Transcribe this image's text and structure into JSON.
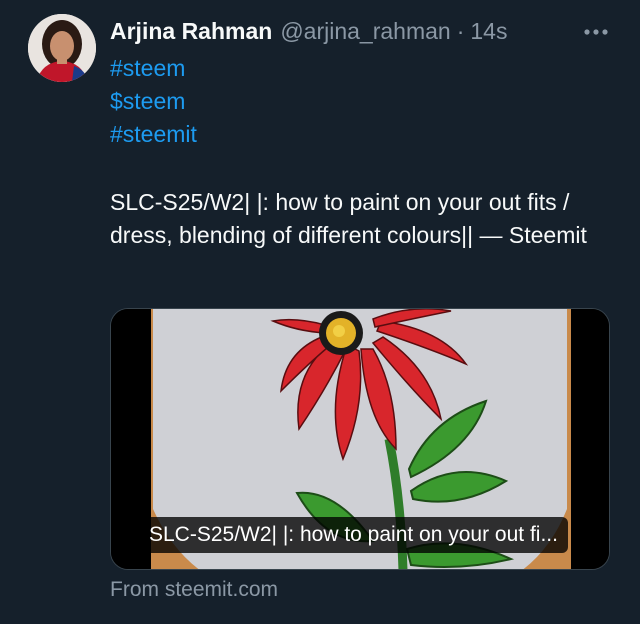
{
  "author": {
    "name": "Arjina Rahman",
    "handle": "@arjina_rahman",
    "separator": "·",
    "time": "14s"
  },
  "tags": [
    "#steem",
    "$steem",
    "#steemit"
  ],
  "body": "SLC-S25/W2| |: how to paint on your out fits / dress, blending of different colours|| — Steemit",
  "card": {
    "title": "SLC-S25/W2| |: how to paint on your out fi...",
    "source": "From steemit.com"
  },
  "icons": {
    "more": "more-horizontal-icon"
  },
  "colors": {
    "background": "#15202b",
    "link": "#1d9bf0",
    "secondary_text": "#8b98a5",
    "primary_text": "#f7f9f9"
  }
}
